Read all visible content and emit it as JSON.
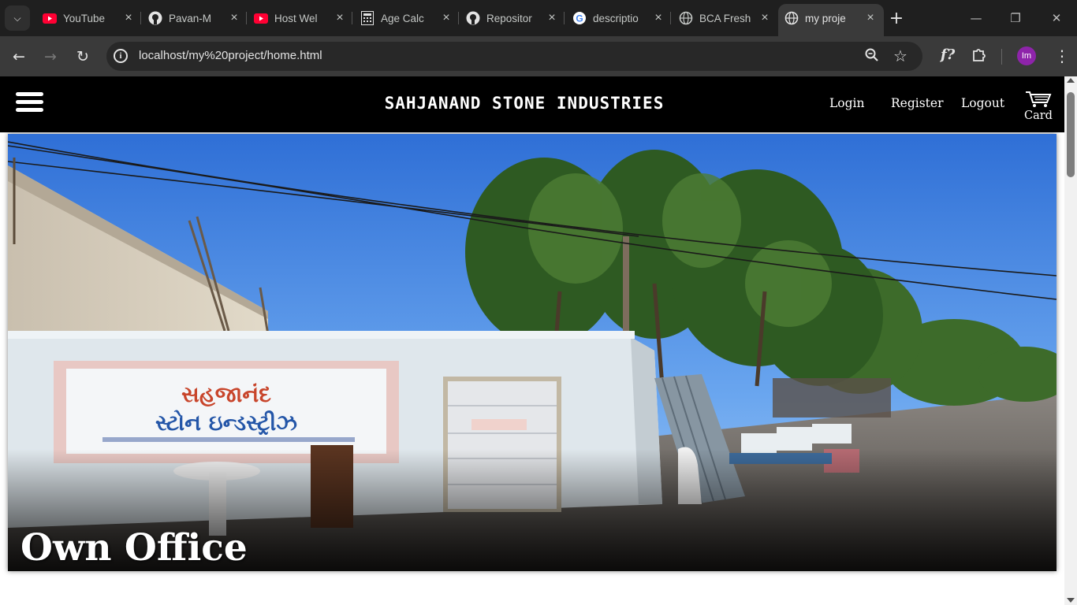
{
  "browser": {
    "tabs": [
      {
        "title": "YouTube",
        "icon": "youtube-icon",
        "active": false
      },
      {
        "title": "Pavan-M",
        "icon": "github-icon",
        "active": false
      },
      {
        "title": "Host Wel",
        "icon": "youtube-icon",
        "active": false
      },
      {
        "title": "Age Calc",
        "icon": "calculator-icon",
        "active": false
      },
      {
        "title": "Repositor",
        "icon": "github-icon",
        "active": false
      },
      {
        "title": "descriptio",
        "icon": "google-icon",
        "active": false
      },
      {
        "title": "BCA Fresh",
        "icon": "globe-icon",
        "active": false
      },
      {
        "title": "my proje",
        "icon": "globe-icon",
        "active": true
      }
    ],
    "url": "localhost/my%20project/home.html",
    "profile_initials": "Im",
    "colors": {
      "tab_bar": "#1f1f1f",
      "toolbar": "#3a3a3a",
      "omnibox": "#282828",
      "avatar": "#8e24aa"
    }
  },
  "site": {
    "brand": "SAHJANAND STONE INDUSTRIES",
    "nav": {
      "login": "Login",
      "register": "Register",
      "logout": "Logout",
      "cart": "Card"
    },
    "hero": {
      "caption": "Own Office",
      "sign_line1": "સહજાનંદ",
      "sign_line2": "સ્ટોન ઇન્ડસ્ટ્રીઝ"
    },
    "colors": {
      "header": "#000000",
      "text": "#ffffff"
    }
  }
}
